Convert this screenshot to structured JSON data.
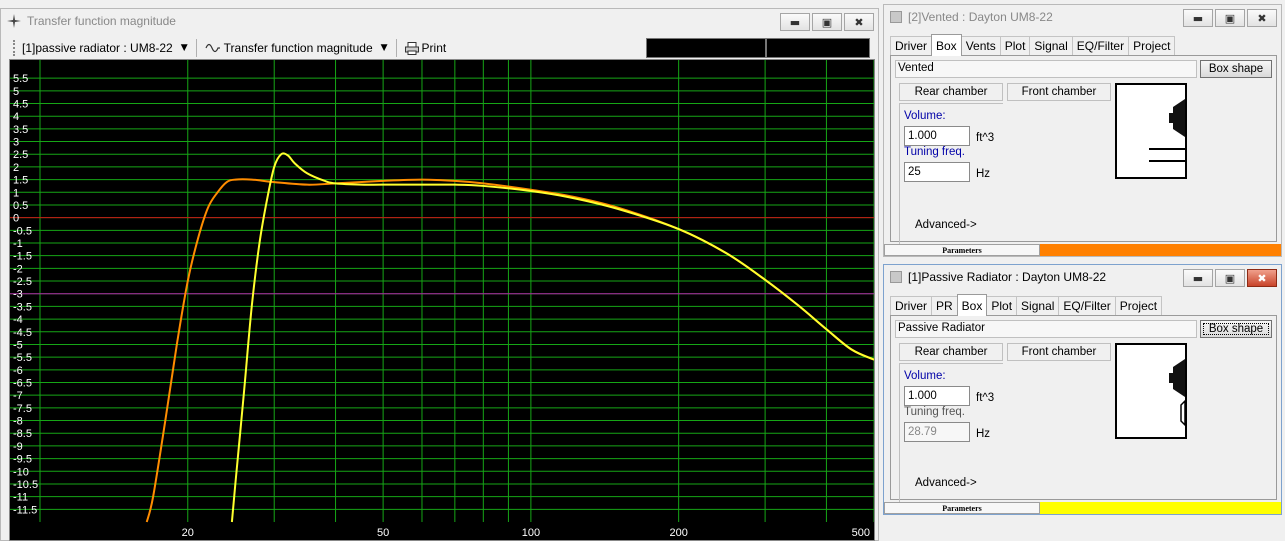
{
  "colors": {
    "grid": "#16a616",
    "zero_line": "#c81414",
    "ref_line": "#b01fa8",
    "series_vented": "#ff8c00",
    "series_passive": "#ffff2e",
    "status_vented": "#ff8000",
    "status_passive": "#ffff00"
  },
  "main_window": {
    "title": "Transfer function magnitude",
    "icon": "crosshair-icon",
    "toolbar": {
      "system_select": "[1]passive radiator : UM8-22",
      "plot_select": "Transfer function magnitude",
      "plot_icon": "waveform-icon",
      "print_label": "Print",
      "print_icon": "printer-icon"
    }
  },
  "chart_data": {
    "type": "line",
    "xscale": "log",
    "xlim": [
      10,
      500
    ],
    "ylim": [
      -12,
      5.9
    ],
    "x_tick_labels": [
      20,
      50,
      100,
      200,
      500
    ],
    "y_tick_labels": [
      "5.5",
      "5",
      "4.5",
      "4",
      "3.5",
      "3",
      "2.5",
      "2",
      "1.5",
      "1",
      "0.5",
      "0",
      "-0.5",
      "-1",
      "-1.5",
      "-2",
      "-2.5",
      "-3",
      "-3.5",
      "-4",
      "-4.5",
      "-5",
      "-5.5",
      "-6",
      "-6.5",
      "-7",
      "-7.5",
      "-8",
      "-8.5",
      "-9",
      "-9.5",
      "-10",
      "-10.5",
      "-11",
      "-11.5"
    ],
    "reference_lines": [
      0,
      -3
    ],
    "grid": true,
    "series": [
      {
        "key": "vented",
        "color_key": "series_vented",
        "x": [
          16.5,
          17,
          18,
          19,
          20,
          21,
          22,
          23,
          24,
          25,
          27,
          30,
          35,
          40,
          50,
          60,
          70,
          80,
          100,
          120,
          150,
          200,
          250,
          300,
          350,
          400,
          450,
          500
        ],
        "y": [
          -12,
          -11,
          -8,
          -5,
          -2.5,
          -0.8,
          0.4,
          1.0,
          1.4,
          1.5,
          1.5,
          1.4,
          1.3,
          1.35,
          1.45,
          1.5,
          1.45,
          1.35,
          1.1,
          0.85,
          0.4,
          -0.45,
          -1.4,
          -2.45,
          -3.45,
          -4.4,
          -5.2,
          -5.6
        ]
      },
      {
        "key": "passive",
        "color_key": "series_passive",
        "x": [
          24.6,
          25,
          26,
          27,
          28,
          29,
          30,
          31,
          32,
          33,
          35,
          38,
          40,
          45,
          50,
          60,
          70,
          80,
          100,
          120,
          150,
          200,
          250,
          300,
          350,
          400,
          450,
          500
        ],
        "y": [
          -12,
          -10.5,
          -7,
          -3.5,
          -1.0,
          0.7,
          2.0,
          2.5,
          2.45,
          2.15,
          1.75,
          1.45,
          1.35,
          1.3,
          1.3,
          1.3,
          1.3,
          1.25,
          1.05,
          0.8,
          0.35,
          -0.45,
          -1.4,
          -2.45,
          -3.45,
          -4.4,
          -5.2,
          -5.6
        ]
      }
    ]
  },
  "vented_window": {
    "title": "[2]Vented : Dayton UM8-22",
    "tabs": [
      "Driver",
      "Box",
      "Vents",
      "Plot",
      "Signal",
      "EQ/Filter",
      "Project"
    ],
    "active_tab": "Box",
    "box_type": "Vented",
    "box_shape_button": "Box shape",
    "rear_chamber_button": "Rear chamber",
    "front_chamber_button": "Front chamber",
    "volume_label": "Volume:",
    "volume_value": "1.000",
    "volume_unit": "ft^3",
    "tuning_label": "Tuning freq.",
    "tuning_value": "25",
    "tuning_unit": "Hz",
    "advanced_label": "Advanced->",
    "status_label": "Parameters"
  },
  "passive_window": {
    "title": "[1]Passive Radiator : Dayton UM8-22",
    "tabs": [
      "Driver",
      "PR",
      "Box",
      "Plot",
      "Signal",
      "EQ/Filter",
      "Project"
    ],
    "active_tab": "Box",
    "box_type": "Passive Radiator",
    "box_shape_button": "Box shape",
    "rear_chamber_button": "Rear chamber",
    "front_chamber_button": "Front chamber",
    "volume_label": "Volume:",
    "volume_value": "1.000",
    "volume_unit": "ft^3",
    "tuning_label": "Tuning freq.",
    "tuning_value": "28.79",
    "tuning_unit": "Hz",
    "advanced_label": "Advanced->",
    "status_label": "Parameters"
  }
}
